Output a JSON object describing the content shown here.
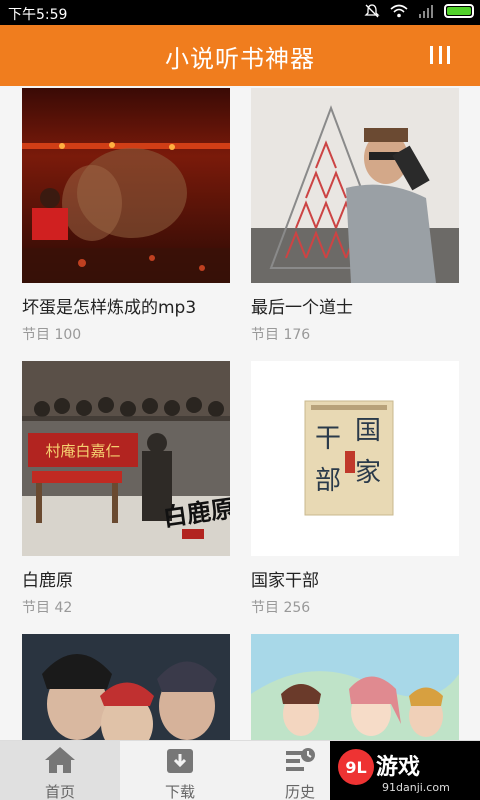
{
  "status_bar": {
    "time": "下午5:59",
    "icons": [
      "mute-icon",
      "wifi-icon",
      "signal-icon",
      "battery-icon"
    ],
    "battery_color": "#52d12b"
  },
  "header": {
    "title": "小说听书神器",
    "background": "#f07d1e",
    "menu_icon": "menu-icon"
  },
  "books": [
    {
      "name": "坏蛋是怎样炼成的mp3",
      "count": "节目 100"
    },
    {
      "name": "最后一个道士",
      "count": "节目 176"
    },
    {
      "name": "白鹿原",
      "count": "节目 42"
    },
    {
      "name": "国家干部",
      "count": "节目 256"
    },
    {
      "name": "",
      "count": ""
    },
    {
      "name": "",
      "count": ""
    }
  ],
  "cover_text": {
    "bailuyuan_banner": "村庵白嘉仁",
    "bailuyuan_title": "白鹿原",
    "guojia_line1": "国",
    "guojia_line2": "家",
    "guojia_line3": "干",
    "guojia_line4": "部"
  },
  "bottom_nav": {
    "tabs": [
      {
        "label": "首页",
        "icon": "home-icon",
        "active": true
      },
      {
        "label": "下载",
        "icon": "download-icon",
        "active": false
      },
      {
        "label": "历史",
        "icon": "history-icon",
        "active": false
      }
    ]
  },
  "watermark": {
    "logo": "9L",
    "text": "游戏",
    "url": "91danji.com"
  }
}
